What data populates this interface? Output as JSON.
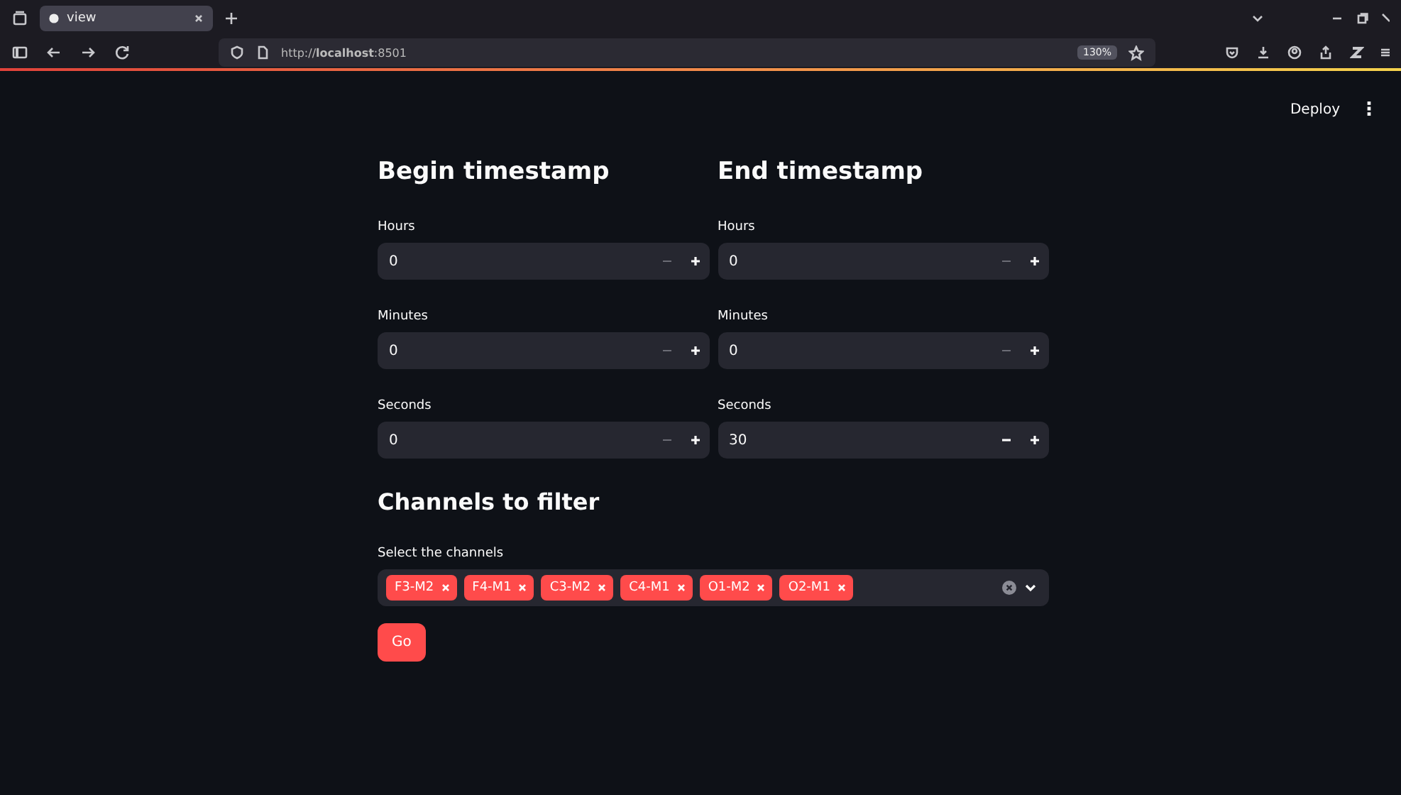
{
  "browser": {
    "tab_title": "view",
    "url": "http://**localhost**:8501",
    "zoom": "130%"
  },
  "header": {
    "deploy": "Deploy",
    "menu": "⋮"
  },
  "columns": [
    {
      "heading": "Begin timestamp",
      "fields": [
        {
          "label": "Hours",
          "value": "0",
          "minus_disabled": true
        },
        {
          "label": "Minutes",
          "value": "0",
          "minus_disabled": true
        },
        {
          "label": "Seconds",
          "value": "0",
          "minus_disabled": true
        }
      ]
    },
    {
      "heading": "End timestamp",
      "fields": [
        {
          "label": "Hours",
          "value": "0",
          "minus_disabled": true
        },
        {
          "label": "Minutes",
          "value": "0",
          "minus_disabled": true
        },
        {
          "label": "Seconds",
          "value": "30",
          "minus_disabled": false
        }
      ]
    }
  ],
  "channels": {
    "heading": "Channels to filter",
    "label": "Select the channels",
    "tags": [
      "F3-M2",
      "F4-M1",
      "C3-M2",
      "C4-M1",
      "O1-M2",
      "O2-M1"
    ]
  },
  "go_button": "Go"
}
